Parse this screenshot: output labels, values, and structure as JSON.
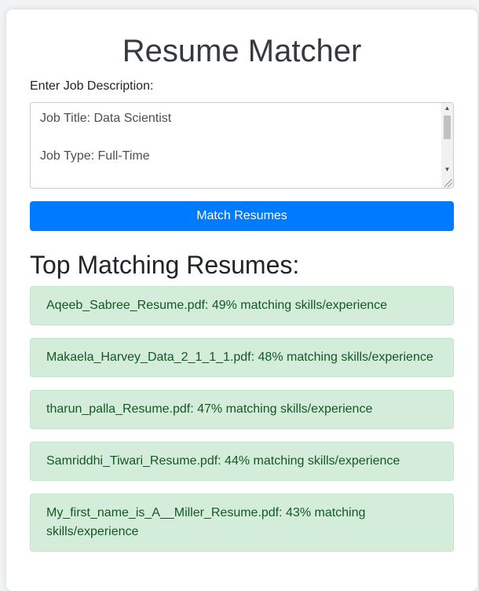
{
  "page": {
    "title": "Resume Matcher"
  },
  "form": {
    "job_description_label": "Enter Job Description:",
    "job_description_value": "Job Title: Data Scientist\n\nJob Type: Full-Time\n\nAbout the Company",
    "submit_label": "Match Resumes"
  },
  "results": {
    "heading": "Top Matching Resumes:",
    "items": [
      {
        "text": "Aqeeb_Sabree_Resume.pdf: 49% matching skills/experience"
      },
      {
        "text": "Makaela_Harvey_Data_2_1_1_1.pdf: 48% matching skills/experience"
      },
      {
        "text": "tharun_palla_Resume.pdf: 47% matching skills/experience"
      },
      {
        "text": "Samriddhi_Tiwari_Resume.pdf: 44% matching skills/experience"
      },
      {
        "text": "My_first_name_is_A__Miller_Resume.pdf: 43% matching skills/experience"
      }
    ]
  },
  "colors": {
    "primary_button": "#007bff",
    "result_background": "#d4edda",
    "result_text": "#155724"
  },
  "icons": {
    "scroll_up": "triangle-up-icon",
    "scroll_down": "triangle-down-icon",
    "resize_grip": "resize-grip-icon"
  }
}
